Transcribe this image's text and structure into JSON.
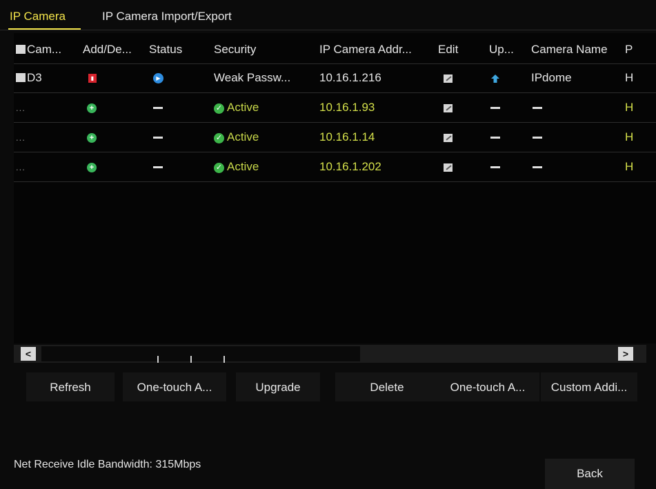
{
  "tabs": [
    {
      "label": "IP Camera",
      "active": true
    },
    {
      "label": "IP Camera Import/Export",
      "active": false
    }
  ],
  "table": {
    "columns": [
      "Cam...",
      "Add/De...",
      "Status",
      "Security",
      "IP Camera Addr...",
      "Edit",
      "Up...",
      "Camera Name",
      "P"
    ],
    "rows": [
      {
        "camera": "D3",
        "add": "delete-icon",
        "status": "play-icon",
        "security": "Weak Passw...",
        "ip": "10.16.1.216",
        "edit": "edit-icon",
        "upgrade": "upgrade-icon",
        "name": "IPdome",
        "protocol": "H"
      },
      {
        "camera": "...",
        "add": "add-icon",
        "status": "-",
        "security": "Active",
        "ip": "10.16.1.93",
        "edit": "edit-icon",
        "upgrade": "-",
        "name": "-",
        "protocol": "H"
      },
      {
        "camera": "...",
        "add": "add-icon",
        "status": "-",
        "security": "Active",
        "ip": "10.16.1.14",
        "edit": "edit-icon",
        "upgrade": "-",
        "name": "-",
        "protocol": "H"
      },
      {
        "camera": "...",
        "add": "add-icon",
        "status": "-",
        "security": "Active",
        "ip": "10.16.1.202",
        "edit": "edit-icon",
        "upgrade": "-",
        "name": "-",
        "protocol": "H"
      }
    ]
  },
  "scrollbar": {
    "left": "<",
    "right": ">"
  },
  "buttons": [
    "Refresh",
    "One-touch A...",
    "Upgrade",
    "Delete",
    "One-touch A...",
    "Custom Addi..."
  ],
  "footer": {
    "bandwidth": "Net Receive Idle Bandwidth: 315Mbps",
    "back": "Back"
  },
  "colors": {
    "accent": "#f2e34a",
    "active_text": "#c8d84a",
    "background": "#0b0b0b"
  }
}
